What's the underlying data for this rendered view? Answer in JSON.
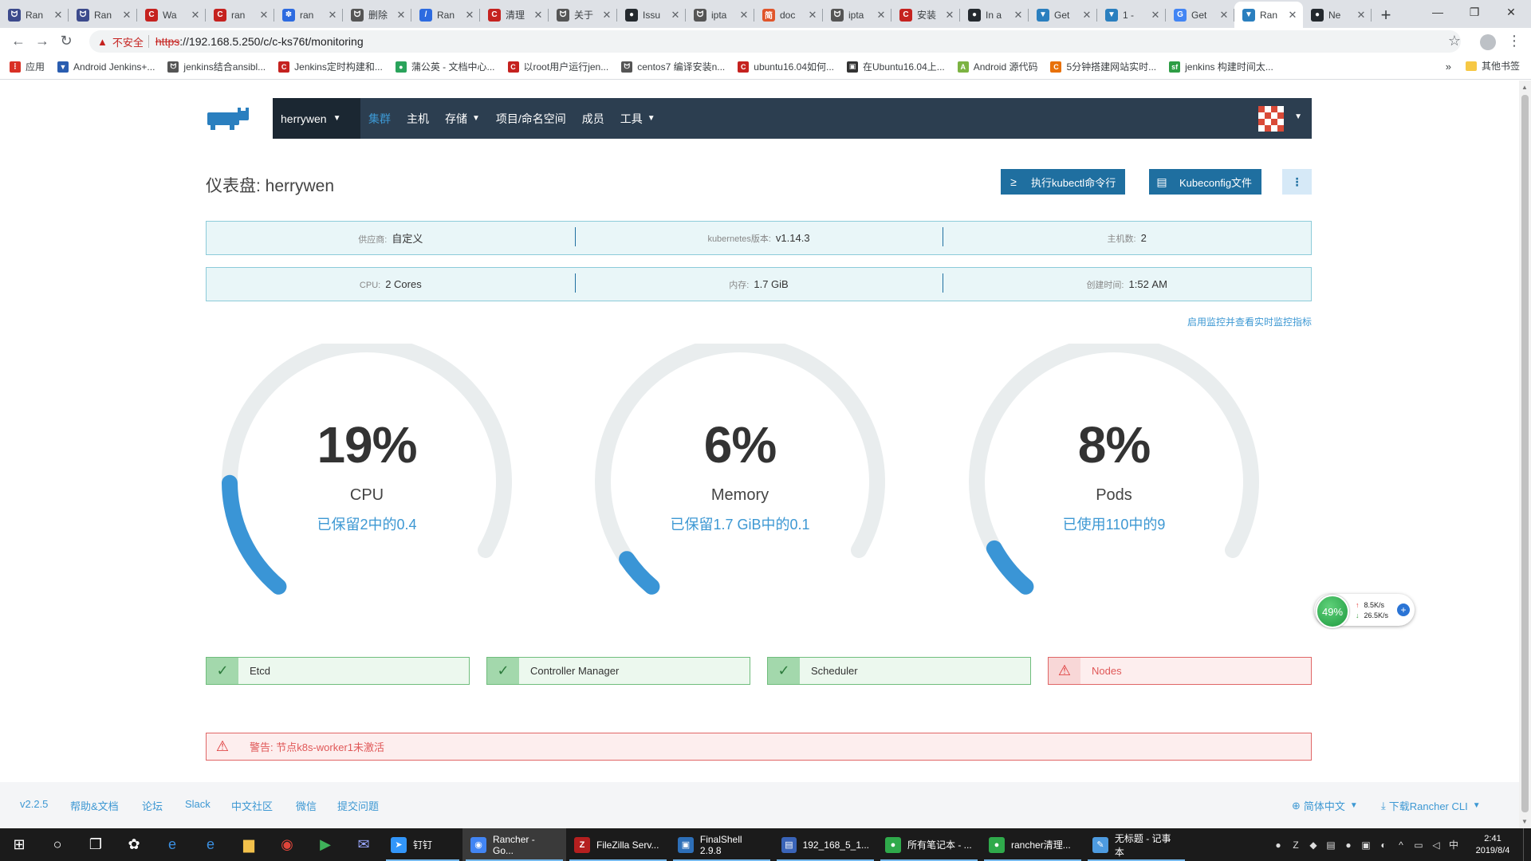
{
  "browser": {
    "tabs": [
      {
        "label": "Ran",
        "color": "#3c4a8c",
        "glyph": "ᗢ"
      },
      {
        "label": "Ran",
        "color": "#3c4a8c",
        "glyph": "ᗢ"
      },
      {
        "label": "Wa",
        "color": "#c5221f",
        "glyph": "C"
      },
      {
        "label": "ran",
        "color": "#c5221f",
        "glyph": "C"
      },
      {
        "label": "ran",
        "color": "#2d6be0",
        "glyph": "✽"
      },
      {
        "label": "删除",
        "color": "#555555",
        "glyph": "ᗢ"
      },
      {
        "label": "Ran",
        "color": "#2d6be0",
        "glyph": "/"
      },
      {
        "label": "清理",
        "color": "#c5221f",
        "glyph": "C"
      },
      {
        "label": "关于",
        "color": "#555555",
        "glyph": "ᗢ"
      },
      {
        "label": "Issu",
        "color": "#24292e",
        "glyph": "●"
      },
      {
        "label": "ipta",
        "color": "#555555",
        "glyph": "ᗢ"
      },
      {
        "label": "doc",
        "color": "#e0552b",
        "glyph": "简"
      },
      {
        "label": "ipta",
        "color": "#555555",
        "glyph": "ᗢ"
      },
      {
        "label": "安装",
        "color": "#c5221f",
        "glyph": "C"
      },
      {
        "label": "In a",
        "color": "#24292e",
        "glyph": "●"
      },
      {
        "label": "Get",
        "color": "#2a7fbf",
        "glyph": "▼"
      },
      {
        "label": "1 -",
        "color": "#2a7fbf",
        "glyph": "▼"
      },
      {
        "label": "Get",
        "color": "#4285f4",
        "glyph": "G"
      },
      {
        "label": "Ran",
        "color": "#2a7fbf",
        "glyph": "▼"
      },
      {
        "label": "Ne",
        "color": "#24292e",
        "glyph": "●"
      }
    ],
    "active_tab_index": 18,
    "new_tab": "+",
    "window_controls": [
      "—",
      "❐",
      "✕"
    ],
    "nav": {
      "back": "←",
      "forward": "→",
      "reload": "↻"
    },
    "security_label": "不安全",
    "url_protocol": "https",
    "url_rest": "://192.168.5.250/c/c-ks76t/monitoring",
    "bookmarks": [
      {
        "label": "应用",
        "color": "#d93025",
        "glyph": "⋮"
      },
      {
        "label": "Android Jenkins+...",
        "color": "#2a5db0",
        "glyph": "▼"
      },
      {
        "label": "jenkins结合ansibl...",
        "color": "#555555",
        "glyph": "ᗢ"
      },
      {
        "label": "Jenkins定时构建和...",
        "color": "#c5221f",
        "glyph": "C"
      },
      {
        "label": "蒲公英 - 文档中心...",
        "color": "#2aa35b",
        "glyph": "●"
      },
      {
        "label": "以root用户运行jen...",
        "color": "#c5221f",
        "glyph": "C"
      },
      {
        "label": "centos7 编译安装n...",
        "color": "#555555",
        "glyph": "ᗢ"
      },
      {
        "label": "ubuntu16.04如何...",
        "color": "#c5221f",
        "glyph": "C"
      },
      {
        "label": "在Ubuntu16.04上...",
        "color": "#333333",
        "glyph": "▣"
      },
      {
        "label": "Android 源代码",
        "color": "#7cb342",
        "glyph": "A"
      },
      {
        "label": "5分钟搭建网站实时...",
        "color": "#e8710a",
        "glyph": "C"
      },
      {
        "label": "jenkins 构建时间太...",
        "color": "#2e9d45",
        "glyph": "sf"
      }
    ],
    "bookmarks_more": "»",
    "other_bookmarks": "其他书签"
  },
  "nav": {
    "cluster_name": "herrywen",
    "items": [
      {
        "label": "集群",
        "active": true,
        "dropdown": false
      },
      {
        "label": "主机",
        "active": false,
        "dropdown": false
      },
      {
        "label": "存储",
        "active": false,
        "dropdown": true
      },
      {
        "label": "项目/命名空间",
        "active": false,
        "dropdown": false
      },
      {
        "label": "成员",
        "active": false,
        "dropdown": false
      },
      {
        "label": "工具",
        "active": false,
        "dropdown": true
      }
    ]
  },
  "header": {
    "title": "仪表盘: herrywen",
    "kubectl_button": "执行kubectl命令行",
    "kubeconfig_button": "Kubeconfig文件",
    "kubectl_icon": "≥",
    "kubeconfig_icon": "▤",
    "more_icon": "⋮"
  },
  "info_row1": [
    {
      "key": "供应商:",
      "value": "自定义"
    },
    {
      "key": "kubernetes版本:",
      "value": "v1.14.3"
    },
    {
      "key": "主机数:",
      "value": "2"
    }
  ],
  "info_row2": [
    {
      "key": "CPU:",
      "value": "2 Cores"
    },
    {
      "key": "内存:",
      "value": "1.7 GiB"
    },
    {
      "key": "创建时间:",
      "value": "1:52 AM"
    }
  ],
  "monitoring_link": "启用监控并查看实时监控指标",
  "gauges": [
    {
      "value": "19%",
      "fraction": 0.19,
      "label": "CPU",
      "sub": "已保留2中的0.4"
    },
    {
      "value": "6%",
      "fraction": 0.06,
      "label": "Memory",
      "sub": "已保留1.7 GiB中的0.1"
    },
    {
      "value": "8%",
      "fraction": 0.08,
      "label": "Pods",
      "sub": "已使用110中的9"
    }
  ],
  "colors": {
    "gauge_track": "#e9edee",
    "gauge_fill": "#3a95d6",
    "nav_bg": "#2c3e50",
    "accent": "#3d98d3"
  },
  "network_widget": {
    "percent": "49%",
    "up": "8.5K/s",
    "down": "26.5K/s"
  },
  "components": [
    {
      "label": "Etcd",
      "status": "ok"
    },
    {
      "label": "Controller Manager",
      "status": "ok"
    },
    {
      "label": "Scheduler",
      "status": "ok"
    },
    {
      "label": "Nodes",
      "status": "error"
    }
  ],
  "alert": "警告: 节点k8s-worker1未激活",
  "footer": {
    "version": "v2.2.5",
    "links": [
      "帮助&文档",
      "论坛",
      "Slack",
      "中文社区",
      "微信",
      "提交问题"
    ],
    "language": "简体中文",
    "download": "下载Rancher CLI"
  },
  "taskbar": {
    "apps": [
      {
        "label": "Rancher - Go...",
        "color": "#4285f4",
        "glyph": "◉"
      },
      {
        "label": "FileZilla Serv...",
        "color": "#b51f1f",
        "glyph": "Z"
      },
      {
        "label": "FinalShell 2.9.8",
        "color": "#2d6fb8",
        "glyph": "▣"
      },
      {
        "label": "192_168_5_1...",
        "color": "#3a64b8",
        "glyph": "▤"
      },
      {
        "label": "所有笔记本 - ...",
        "color": "#2faa4b",
        "glyph": "●"
      },
      {
        "label": "rancher清理...",
        "color": "#2faa4b",
        "glyph": "●"
      },
      {
        "label": "无标题 - 记事本",
        "color": "#4d9be0",
        "glyph": "✎"
      }
    ],
    "pinned_label": "钉钉",
    "ime": "中",
    "time": "2:41",
    "date": "2019/8/4"
  }
}
